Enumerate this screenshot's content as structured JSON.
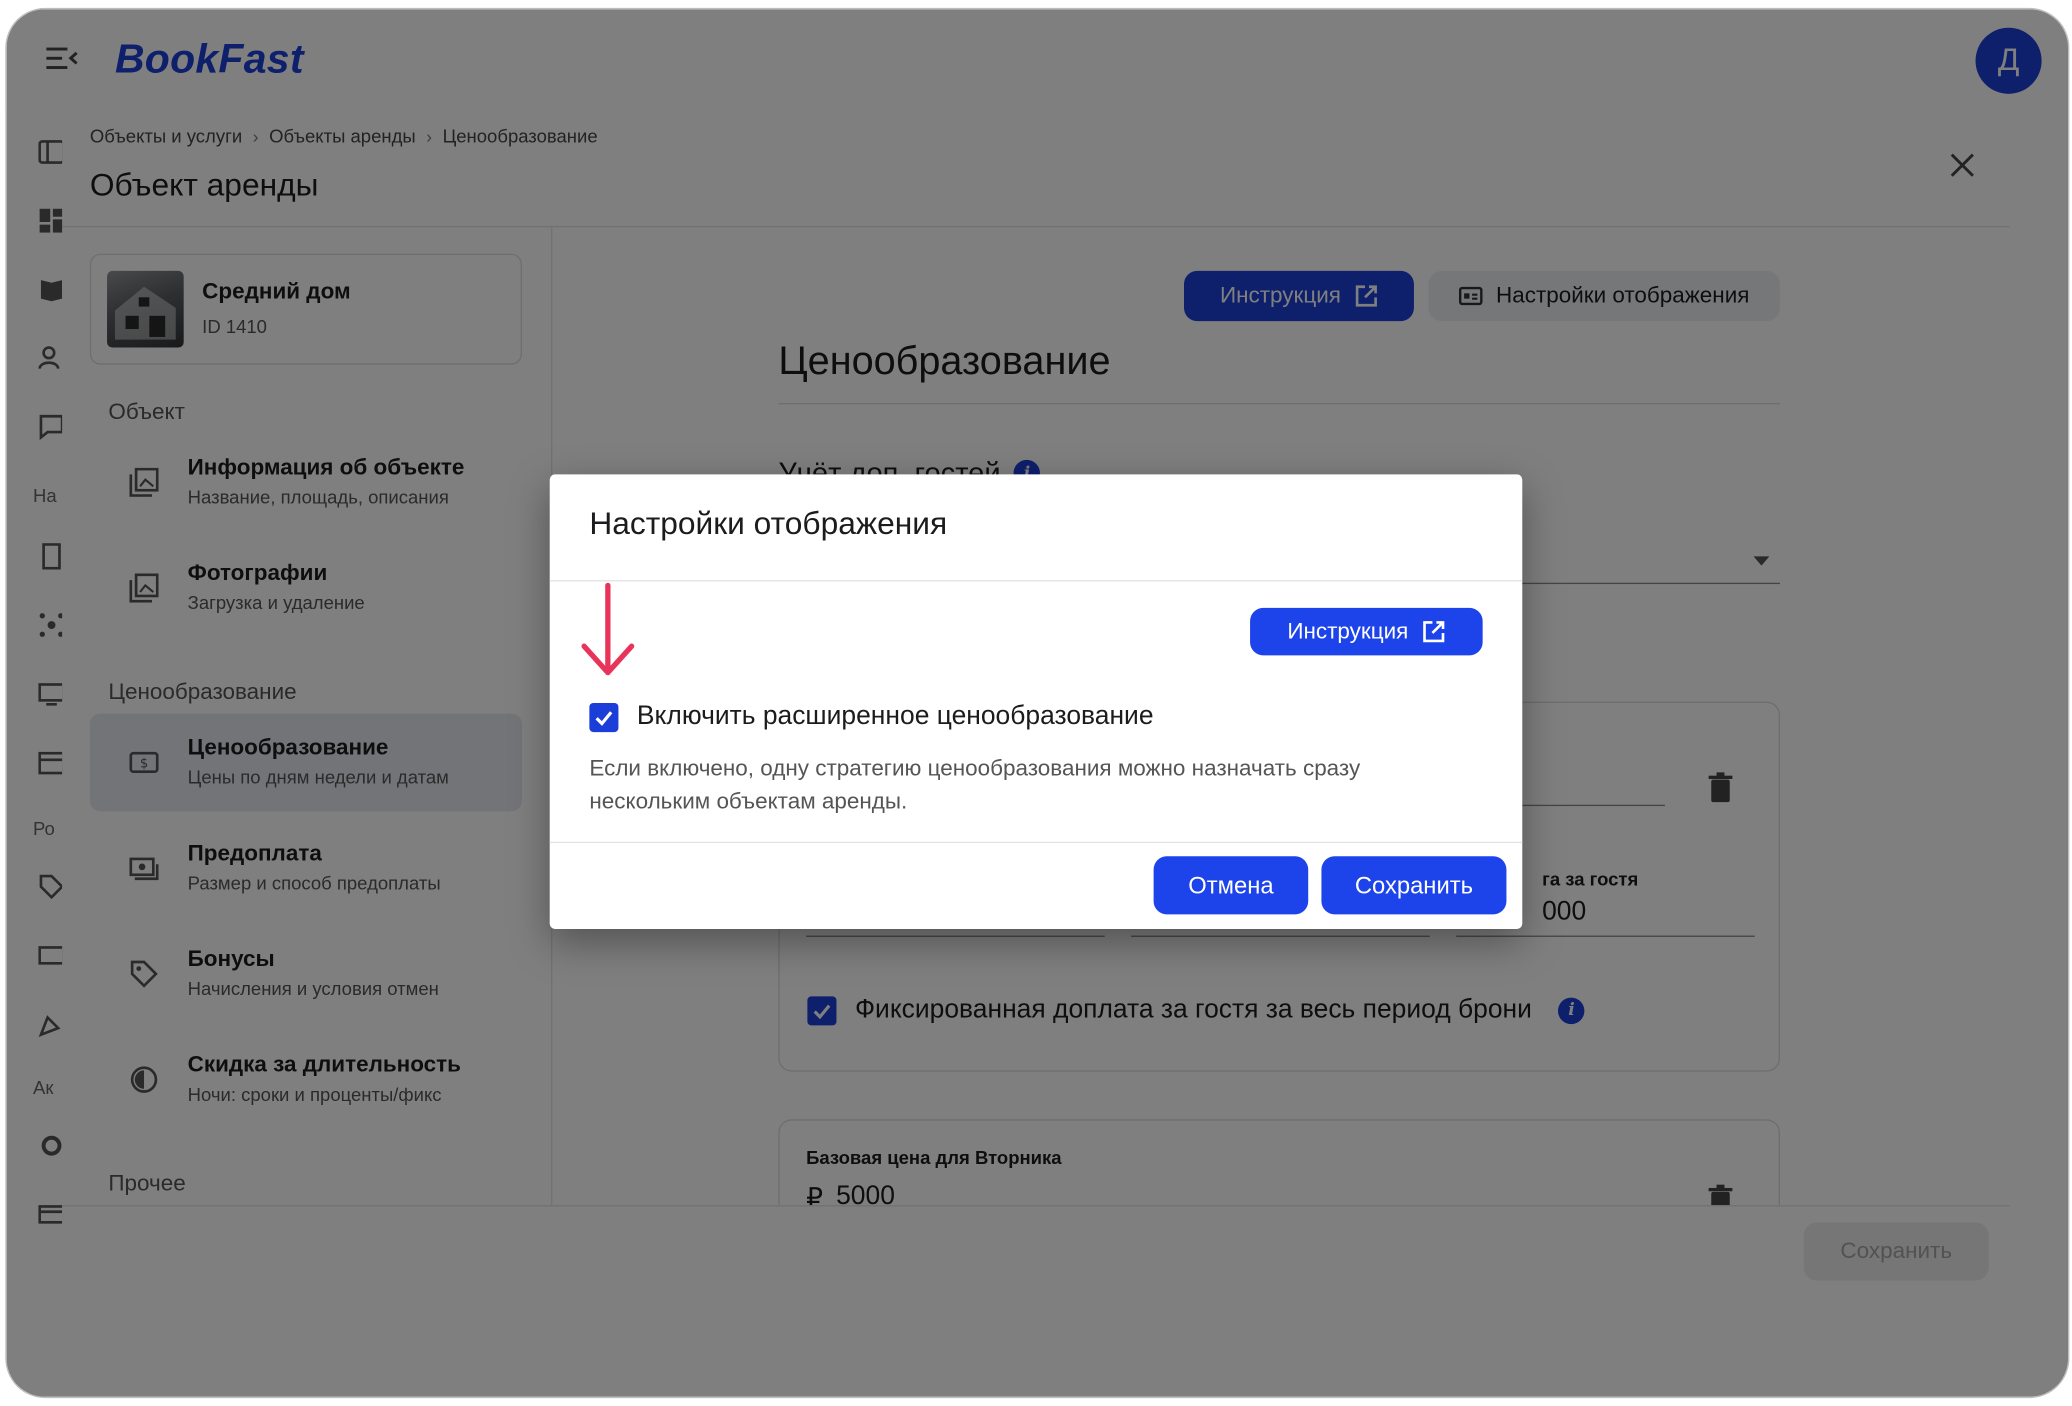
{
  "app": {
    "logo": "BookFast",
    "avatar_letter": "Д"
  },
  "rail": {
    "labels": [
      "На",
      "Ро",
      "Ак"
    ]
  },
  "breadcrumbs": [
    "Объекты и услуги",
    "Объекты аренды",
    "Ценообразование"
  ],
  "breadcrumb_sep": "›",
  "page_title": "Объект аренды",
  "object_card": {
    "name": "Средний дом",
    "id": "ID 1410"
  },
  "sidebar": {
    "groups": [
      "Объект",
      "Ценообразование",
      "Прочее"
    ],
    "items": [
      {
        "title": "Информация об объекте",
        "subtitle": "Название, площадь, описания"
      },
      {
        "title": "Фотографии",
        "subtitle": "Загрузка и удаление"
      },
      {
        "title": "Ценообразование",
        "subtitle": "Цены по дням недели и датам"
      },
      {
        "title": "Предоплата",
        "subtitle": "Размер и способ предоплаты"
      },
      {
        "title": "Бонусы",
        "subtitle": "Начисления и условия отмен"
      },
      {
        "title": "Скидка за длительность",
        "subtitle": "Ночи: сроки и проценты/фикс"
      }
    ]
  },
  "main": {
    "instruction_label": "Инструкция",
    "display_settings_label": "Настройки отображения",
    "title": "Ценообразование",
    "guests_heading": "Учёт доп. гостей",
    "surcharge_label": "га за гостя",
    "surcharge_value": "000",
    "fixed_surcharge_label": "Фиксированная доплата за гостя за весь период брони",
    "tuesday_label": "Базовая цена для Вторника",
    "currency": "₽",
    "tuesday_value": "5000",
    "save_label": "Сохранить"
  },
  "dialog": {
    "title": "Настройки отображения",
    "instruction_label": "Инструкция",
    "checkbox_label": "Включить расширенное ценообразование",
    "checkbox_checked": true,
    "description": "Если включено, одну стратегию ценообразования можно назначать сразу нескольким объектам аренды.",
    "cancel_label": "Отмена",
    "save_label": "Сохранить"
  },
  "colors": {
    "brand": "#1c3ed8",
    "accent_button": "#1d43ea",
    "annotation_arrow": "#e8335a"
  }
}
